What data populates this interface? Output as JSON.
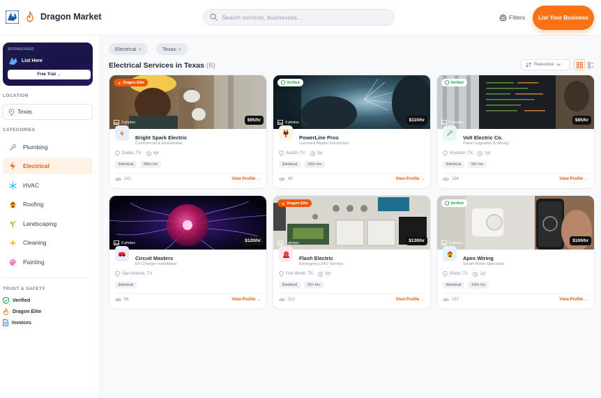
{
  "header": {
    "brand": "Dragon Market",
    "search_placeholder": "Search services, businesses...",
    "filters_label": "Filters",
    "list_button": "List Your Business"
  },
  "sidebar": {
    "ad": {
      "sponsored": "SPONSORED",
      "headline": "List Here",
      "cta": "Free Trial →"
    },
    "location_header": "LOCATION",
    "location_value": "Texas",
    "categories_header": "CATEGORIES",
    "categories": [
      {
        "label": "Plumbing",
        "icon": "wrench-icon"
      },
      {
        "label": "Electrical",
        "icon": "lightning-icon",
        "active": true
      },
      {
        "label": "HVAC",
        "icon": "snowflake-icon"
      },
      {
        "label": "Roofing",
        "icon": "house-icon"
      },
      {
        "label": "Landscaping",
        "icon": "plant-icon"
      },
      {
        "label": "Cleaning",
        "icon": "sparkle-icon"
      },
      {
        "label": "Painting",
        "icon": "palette-icon"
      }
    ],
    "trust_header": "TRUST & SAFETY",
    "trust_items": [
      {
        "label": "Verified",
        "icon": "shield-check-icon"
      },
      {
        "label": "Dragon Elite",
        "icon": "flame-icon"
      },
      {
        "label": "Invoices",
        "icon": "document-icon"
      }
    ]
  },
  "main": {
    "chips": [
      "Electrical",
      "Texas"
    ],
    "chip_remove": "×",
    "title": "Electrical Services in Texas",
    "count": "(6)",
    "sort_label": "Relevance",
    "listings": [
      {
        "badge": "Dragon Elite",
        "badge_type": "elite",
        "photos": "3 photos",
        "price": "$95/hr",
        "name": "Bright Spark Electric",
        "subtitle": "Commercial & Residential",
        "city": "Dallas, TX",
        "years": "4yr",
        "tags": [
          "Electrical",
          "500+ Inv"
        ],
        "views": "142",
        "cta": "View Profile →",
        "avatar_color": "#e6efff",
        "avatar_icon": "lightning-icon"
      },
      {
        "badge": "Verified",
        "badge_type": "verified",
        "photos": "4 photos",
        "price": "$110/hr",
        "name": "PowerLine Pros",
        "subtitle": "Licensed Master Electrician",
        "city": "Austin, TX",
        "years": "2yr",
        "tags": [
          "Electrical",
          "100+ Inv"
        ],
        "views": "89",
        "cta": "View Profile →",
        "avatar_color": "#fff4dd",
        "avatar_icon": "plug-icon"
      },
      {
        "badge": "Verified",
        "badge_type": "verified",
        "photos": "5 photos",
        "price": "$85/hr",
        "name": "Volt Electric Co.",
        "subtitle": "Panel Upgrades & Wiring",
        "city": "Houston, TX",
        "years": "1yr",
        "tags": [
          "Electrical",
          "50+ Inv"
        ],
        "views": "234",
        "cta": "View Profile →",
        "avatar_color": "#e4f8ee",
        "avatar_icon": "wrench-icon"
      },
      {
        "badge": "",
        "badge_type": "",
        "photos": "6 photos",
        "price": "$120/hr",
        "name": "Circuit Masters",
        "subtitle": "EV Charger Installation",
        "city": "San Antonio, TX",
        "years": "",
        "tags": [
          "Electrical"
        ],
        "views": "56",
        "cta": "View Profile →",
        "avatar_color": "#f1e8ff",
        "avatar_icon": "car-icon"
      },
      {
        "badge": "Dragon Elite",
        "badge_type": "elite",
        "photos": "7 photos",
        "price": "$130/hr",
        "name": "Flash Electric",
        "subtitle": "Emergency 24/7 Service",
        "city": "Fort Worth, TX",
        "years": "3yr",
        "tags": [
          "Electrical",
          "1K+ Inv"
        ],
        "views": "312",
        "cta": "View Profile →",
        "avatar_color": "#ffe8ec",
        "avatar_icon": "alarm-icon"
      },
      {
        "badge": "Verified",
        "badge_type": "verified",
        "photos": "8 photos",
        "price": "$100/hr",
        "name": "Apex Wiring",
        "subtitle": "Smart Home Specialist",
        "city": "Plano, TX",
        "years": "2yr",
        "tags": [
          "Electrical",
          "100+ Inv"
        ],
        "views": "167",
        "cta": "View Profile →",
        "avatar_color": "#e3f3ff",
        "avatar_icon": "house-icon"
      }
    ]
  },
  "colors": {
    "accent": "#f97316",
    "active_bg": "#fff3e8",
    "verified": "#16a34a",
    "ad_bg": "#1e1b4b"
  }
}
